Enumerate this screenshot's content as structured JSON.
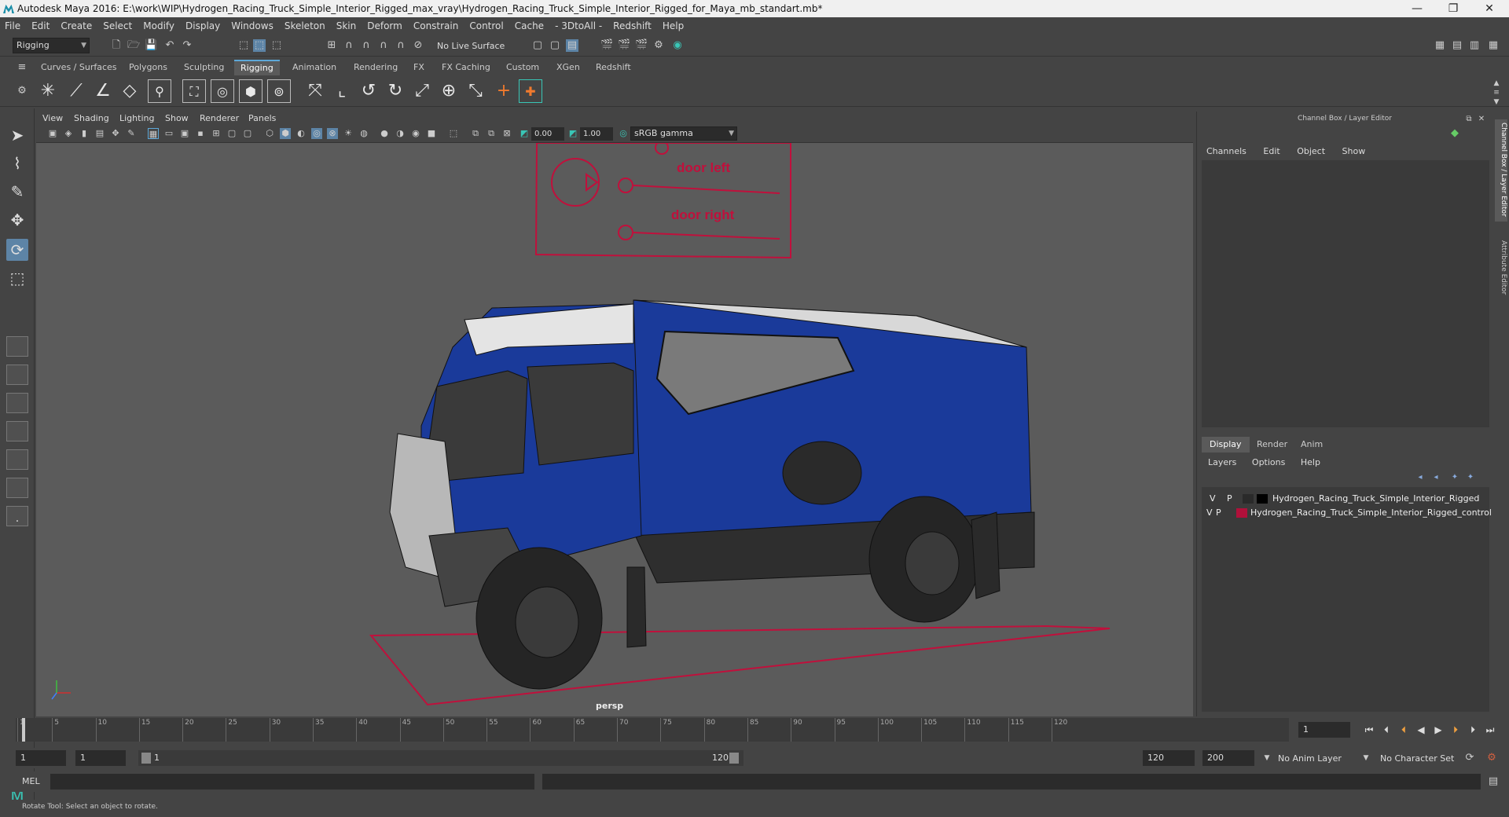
{
  "window": {
    "title": "Autodesk Maya 2016: E:\\work\\WIP\\Hydrogen_Racing_Truck_Simple_Interior_Rigged_max_vray\\Hydrogen_Racing_Truck_Simple_Interior_Rigged_for_Maya_mb_standart.mb*",
    "minimize": "—",
    "restore": "❐",
    "close": "✕"
  },
  "menubar": [
    "File",
    "Edit",
    "Create",
    "Select",
    "Modify",
    "Display",
    "Windows",
    "Skeleton",
    "Skin",
    "Deform",
    "Constrain",
    "Control",
    "Cache",
    "- 3DtoAll -",
    "Redshift",
    "Help"
  ],
  "statusline": {
    "mode": "Rigging",
    "live_surface": "No Live Surface"
  },
  "shelf_tabs": [
    "Curves / Surfaces",
    "Polygons",
    "Sculpting",
    "Rigging",
    "Animation",
    "Rendering",
    "FX",
    "FX Caching",
    "Custom",
    "XGen",
    "Redshift"
  ],
  "active_shelf": "Rigging",
  "viewport": {
    "menus": [
      "View",
      "Shading",
      "Lighting",
      "Show",
      "Renderer",
      "Panels"
    ],
    "exposure": "0.00",
    "gamma": "1.00",
    "color_space": "sRGB gamma",
    "camera_label": "persp",
    "control_labels": [
      "door left",
      "door right"
    ]
  },
  "channel_box": {
    "title": "Channel Box / Layer Editor",
    "menus": [
      "Channels",
      "Edit",
      "Object",
      "Show"
    ],
    "layer_tabs": [
      "Display",
      "Render",
      "Anim"
    ],
    "active_layer_tab": "Display",
    "layer_menus": [
      "Layers",
      "Options",
      "Help"
    ],
    "layers": [
      {
        "v": "V",
        "p": "P",
        "color": "#000000",
        "name": "Hydrogen_Racing_Truck_Simple_Interior_Rigged"
      },
      {
        "v": "V",
        "p": "P",
        "color": "#b0103a",
        "name": "Hydrogen_Racing_Truck_Simple_Interior_Rigged_control"
      }
    ]
  },
  "side_tabs": [
    "Channel Box / Layer Editor",
    "Attribute Editor"
  ],
  "timeline": {
    "ticks": [
      "1",
      "5",
      "10",
      "15",
      "20",
      "25",
      "30",
      "35",
      "40",
      "45",
      "50",
      "55",
      "60",
      "65",
      "70",
      "75",
      "80",
      "85",
      "90",
      "95",
      "100",
      "105",
      "110",
      "115",
      "120"
    ],
    "current_frame": "1"
  },
  "range": {
    "start": "1",
    "playback_start": "1",
    "slider_start": "1",
    "slider_end": "120",
    "playback_end": "120",
    "end": "200",
    "anim_layer": "No Anim Layer",
    "character_set": "No Character Set"
  },
  "command_line": {
    "label": "MEL"
  },
  "help_line": {
    "text": "Rotate Tool: Select an object to rotate."
  }
}
